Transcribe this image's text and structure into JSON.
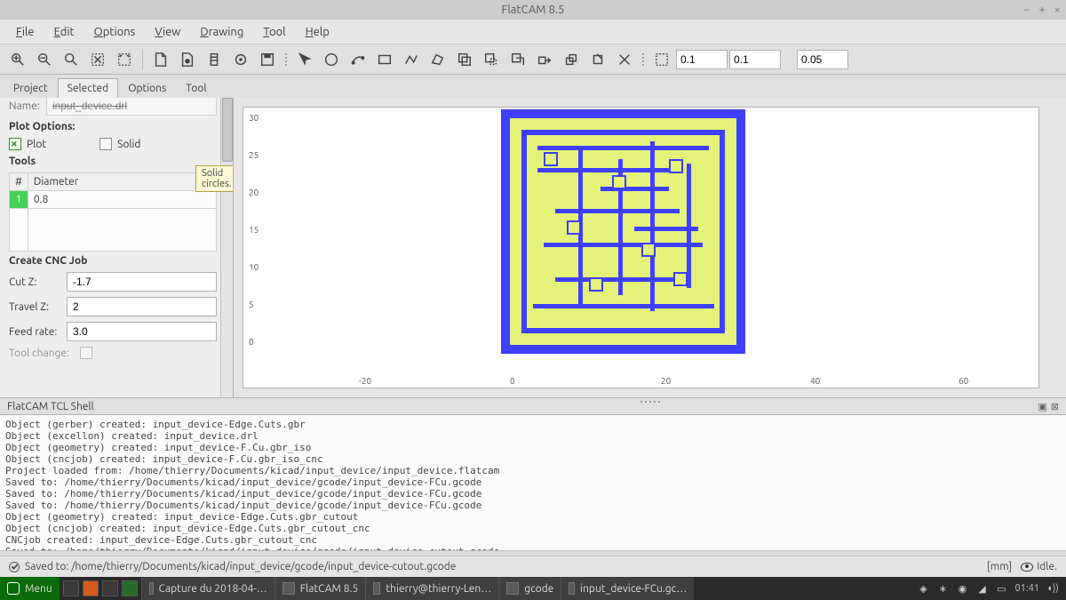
{
  "window": {
    "title": "FlatCAM 8.5"
  },
  "menus": [
    "File",
    "Edit",
    "Options",
    "View",
    "Drawing",
    "Tool",
    "Help"
  ],
  "toolbar_inputs": {
    "a": "0.1",
    "b": "0.1",
    "c": "0.05"
  },
  "tabs": [
    "Project",
    "Selected",
    "Options",
    "Tool"
  ],
  "active_tab": "Selected",
  "panel": {
    "name_label": "Name:",
    "name_value": "input_device.drl",
    "plot_options": "Plot Options:",
    "plot_label": "Plot",
    "solid_label": "Solid",
    "tools_label": "Tools",
    "hash": "#",
    "diameter": "Diameter",
    "dropdown": "▼",
    "tool_rows": [
      {
        "idx": "1",
        "diam": "0.8"
      }
    ],
    "cnc_label": "Create CNC Job",
    "fields": [
      {
        "label": "Cut Z:",
        "value": "-1.7"
      },
      {
        "label": "Travel Z:",
        "value": "2"
      },
      {
        "label": "Feed rate:",
        "value": "3.0"
      }
    ],
    "toolchange_label": "Tool change:",
    "tooltip": "Solid circles."
  },
  "plot": {
    "y_ticks": [
      "30",
      "25",
      "20",
      "15",
      "10",
      "5",
      "0"
    ],
    "x_ticks": [
      "-20",
      "0",
      "20",
      "40",
      "60"
    ]
  },
  "shell_title": "FlatCAM TCL Shell",
  "shell_lines": [
    "Object (gerber) created: input_device-Edge.Cuts.gbr",
    "Object (excellon) created: input_device.drl",
    "Object (geometry) created: input_device-F.Cu.gbr_iso",
    "Object (cncjob) created: input_device-F.Cu.gbr_iso_cnc",
    "Project loaded from: /home/thierry/Documents/kicad/input_device/input_device.flatcam",
    "Saved to: /home/thierry/Documents/kicad/input_device/gcode/input_device-FCu.gcode",
    "Saved to: /home/thierry/Documents/kicad/input_device/gcode/input_device-FCu.gcode",
    "Saved to: /home/thierry/Documents/kicad/input_device/gcode/input_device-FCu.gcode",
    "Object (geometry) created: input_device-Edge.Cuts.gbr_cutout",
    "Object (cncjob) created: input_device-Edge.Cuts.gbr_cutout_cnc",
    "CNCjob created: input_device-Edge.Cuts.gbr_cutout_cnc",
    "Saved to: /home/thierry/Documents/kicad/input_device/gcode/input_device-cutout.gcode"
  ],
  "status": {
    "left": "Saved to: /home/thierry/Documents/kicad/input_device/gcode/input_device-cutout.gcode",
    "units": "[mm]",
    "idle": "Idle."
  },
  "taskbar": {
    "menu": "Menu",
    "tasks": [
      "Capture du 2018-04-…",
      "FlatCAM 8.5",
      "thierry@thierry-Len…",
      "gcode",
      "input_device-FCu.gc…"
    ],
    "clock": "01:41"
  }
}
